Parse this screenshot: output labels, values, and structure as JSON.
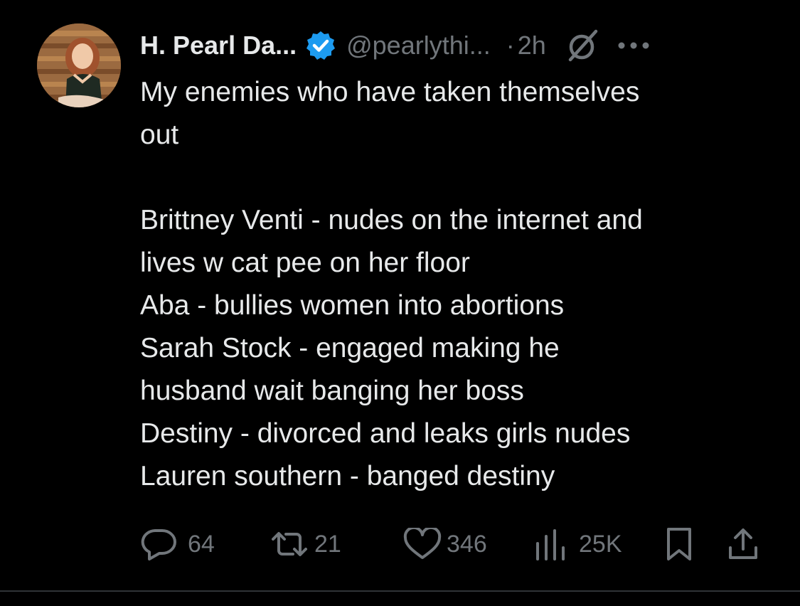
{
  "author": {
    "display_name": "H. Pearl Da...",
    "handle": "@pearlythi...",
    "separator": "·",
    "time": "2h",
    "verified_icon": "verified-badge-icon",
    "verified_color": "#1d9bf0",
    "nosign_icon": "grok-icon",
    "more_icon": "more-horizontal-icon"
  },
  "tweet": {
    "lines": [
      "My enemies who have taken themselves",
      "out",
      "",
      "Brittney Venti - nudes on the internet and",
      "lives w cat pee on her floor",
      "Aba - bullies women into abortions",
      "Sarah Stock - engaged making he",
      "husband wait banging her boss",
      "Destiny - divorced and leaks girls nudes",
      "Lauren southern - banged destiny"
    ]
  },
  "actions": {
    "replies": "64",
    "reposts": "21",
    "likes": "346",
    "views": "25K",
    "reply_icon": "reply-icon",
    "repost_icon": "repost-icon",
    "like_icon": "heart-icon",
    "views_icon": "views-icon",
    "bookmark_icon": "bookmark-icon",
    "share_icon": "share-icon"
  },
  "colors": {
    "background": "#000000",
    "text": "#e7e9ea",
    "muted": "#71767b",
    "divider": "#2f3336"
  }
}
